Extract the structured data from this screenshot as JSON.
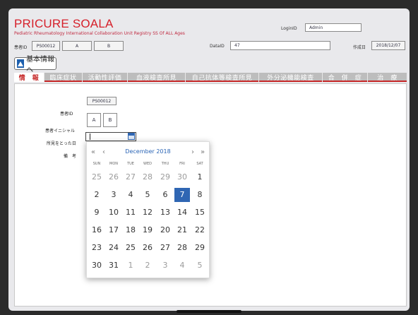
{
  "app": {
    "title": "PRICURE SOALA",
    "subtitle": "Pediatric Rheumatology International Collaboration Unit Registry SS Of ALL Ages"
  },
  "header": {
    "login_label": "LoginID",
    "login_value": "Admin",
    "patient_id_label": "患者ID",
    "patient_id_value": "PS00012",
    "initial_1": "A",
    "initial_2": "B",
    "data_id_label": "DataID",
    "data_id_value": "47",
    "created_label": "作成日",
    "created_value": "2018/12/07"
  },
  "back_button": {
    "label": "基本情報へ"
  },
  "tabs": [
    {
      "label": "情　報",
      "active": true
    },
    {
      "label": "臨床症状",
      "active": false
    },
    {
      "label": "活動性評価",
      "active": false
    },
    {
      "label": "血液検査所見",
      "active": false
    },
    {
      "label": "自己抗体等検査所見",
      "active": false
    },
    {
      "label": "外分泌機能検査",
      "active": false
    },
    {
      "label": "合　併　症",
      "active": false
    },
    {
      "label": "治　療",
      "active": false
    }
  ],
  "form": {
    "patient_id_label": "患者ID",
    "patient_id_value": "PS00012",
    "initials_label": "患者イニシャル",
    "initial_1": "A",
    "initial_2": "B",
    "date_label": "所見をとった日",
    "date_value": "",
    "notes_label": "備　考"
  },
  "calendar": {
    "prev_year": "«",
    "prev_month": "‹",
    "next_month": "›",
    "next_year": "»",
    "month_label": "December 2018",
    "weekdays": [
      "SUN",
      "MON",
      "TUE",
      "WED",
      "THU",
      "FRI",
      "SAT"
    ],
    "weeks": [
      [
        {
          "d": "25",
          "m": true
        },
        {
          "d": "26",
          "m": true
        },
        {
          "d": "27",
          "m": true
        },
        {
          "d": "28",
          "m": true
        },
        {
          "d": "29",
          "m": true
        },
        {
          "d": "30",
          "m": true
        },
        {
          "d": "1"
        }
      ],
      [
        {
          "d": "2"
        },
        {
          "d": "3"
        },
        {
          "d": "4"
        },
        {
          "d": "5"
        },
        {
          "d": "6"
        },
        {
          "d": "7",
          "s": true
        },
        {
          "d": "8"
        }
      ],
      [
        {
          "d": "9"
        },
        {
          "d": "10"
        },
        {
          "d": "11"
        },
        {
          "d": "12"
        },
        {
          "d": "13"
        },
        {
          "d": "14"
        },
        {
          "d": "15"
        }
      ],
      [
        {
          "d": "16"
        },
        {
          "d": "17"
        },
        {
          "d": "18"
        },
        {
          "d": "19"
        },
        {
          "d": "20"
        },
        {
          "d": "21"
        },
        {
          "d": "22"
        }
      ],
      [
        {
          "d": "23"
        },
        {
          "d": "24"
        },
        {
          "d": "25"
        },
        {
          "d": "26"
        },
        {
          "d": "27"
        },
        {
          "d": "28"
        },
        {
          "d": "29"
        }
      ],
      [
        {
          "d": "30"
        },
        {
          "d": "31"
        },
        {
          "d": "1",
          "m": true
        },
        {
          "d": "2",
          "m": true
        },
        {
          "d": "3",
          "m": true
        },
        {
          "d": "4",
          "m": true
        },
        {
          "d": "5",
          "m": true
        }
      ]
    ]
  },
  "colors": {
    "title_red": "#d6202a",
    "tab_active_red": "#c62828",
    "tab_inactive": "#bdbdbd",
    "selected_day": "#2f66b3"
  }
}
